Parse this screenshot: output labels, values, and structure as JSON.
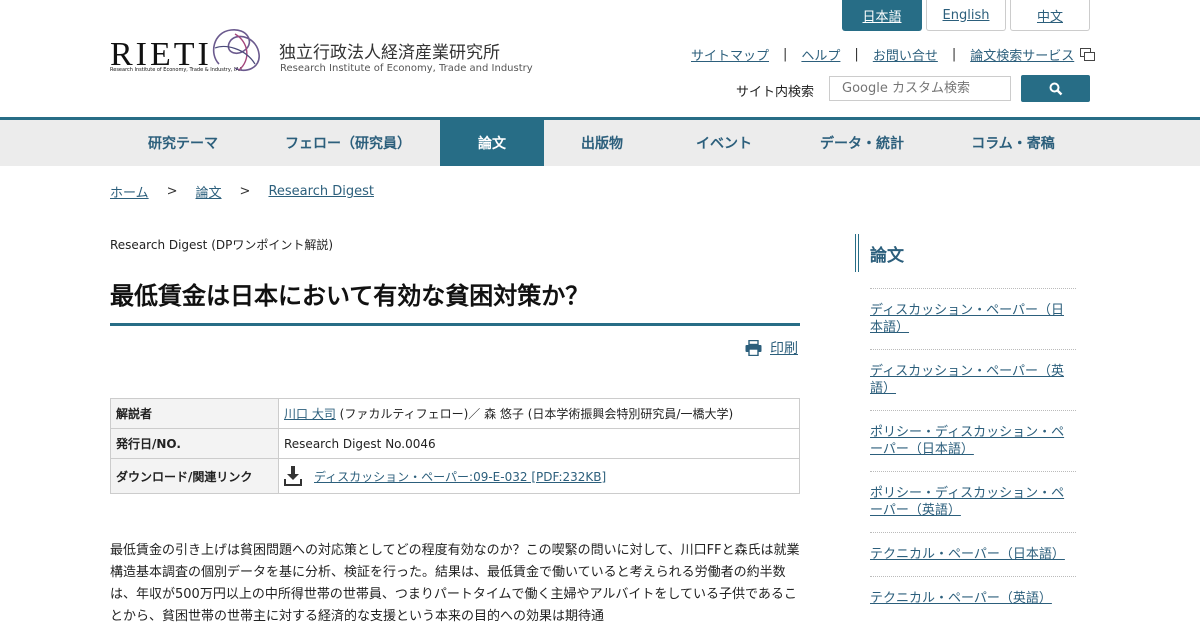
{
  "header": {
    "logo_text": "RIETI",
    "logo_subtext": "Research Institute of Economy, Trade & Industry, IAA",
    "org_name_jp": "独立行政法人経済産業研究所",
    "org_name_en": "Research Institute of Economy, Trade and Industry"
  },
  "lang": [
    "日本語",
    "English",
    "中文"
  ],
  "util_links": [
    "サイトマップ",
    "ヘルプ",
    "お問い合せ",
    "論文検索サービス"
  ],
  "util_separator": "|",
  "search": {
    "label": "サイト内検索",
    "placeholder": "Google カスタム検索"
  },
  "nav": [
    "研究テーマ",
    "フェロー（研究員）",
    "論文",
    "出版物",
    "イベント",
    "データ・統計",
    "コラム・寄稿"
  ],
  "breadcrumb": {
    "items": [
      "ホーム",
      "論文",
      "Research Digest"
    ],
    "separator": ">"
  },
  "article": {
    "kicker": "Research Digest (DPワンポイント解説)",
    "title": "最低賃金は日本において有効な貧困対策か？",
    "print_label": "印刷",
    "info": {
      "commentator_label": "解説者",
      "commentator_link": "川口 大司",
      "commentator_rest": "(ファカルティフェロー)／ 森 悠子 (日本学術振興会特別研究員/一橋大学)",
      "date_label": "発行日/NO.",
      "date_value": "Research Digest No.0046",
      "download_label": "ダウンロード/関連リンク",
      "download_link": "ディスカッション・ペーパー:09-E-032 [PDF:232KB]"
    },
    "body": "最低賃金の引き上げは貧困問題への対応策としてどの程度有効なのか？この喫緊の問いに対して、川口FFと森氏は就業構造基本調査の個別データを基に分析、検証を行った。結果は、最低賃金で働いていると考えられる労働者の約半数は、年収が500万円以上の中所得世帯の世帯員、つまりパートタイムで働く主婦やアルバイトをしている子供であることから、貧困世帯の世帯主に対する経済的な支援という本来の目的への効果は期待通"
  },
  "sidebar": {
    "heading": "論文",
    "items": [
      "ディスカッション・ペーパー（日本語）",
      "ディスカッション・ペーパー（英語）",
      "ポリシー・ディスカッション・ペーパー（日本語）",
      "ポリシー・ディスカッション・ペーパー（英語）",
      "テクニカル・ペーパー（日本語）",
      "テクニカル・ペーパー（英語）"
    ]
  },
  "colors": {
    "accent": "#276d86",
    "link": "#2c5f7c",
    "nav_bg": "#ececec"
  }
}
